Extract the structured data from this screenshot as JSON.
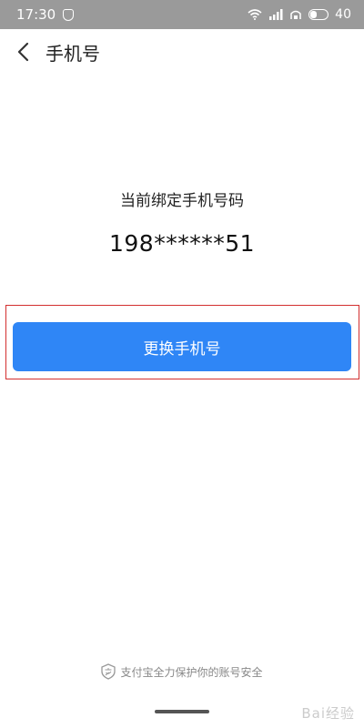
{
  "status_bar": {
    "time": "17:30",
    "battery": "40"
  },
  "header": {
    "title": "手机号",
    "back_icon": "chevron-left-icon"
  },
  "main": {
    "bound_label": "当前绑定手机号码",
    "phone_masked": "198******51",
    "change_button_label": "更换手机号"
  },
  "footer": {
    "security_note": "支付宝全力保护你的账号安全"
  },
  "watermark": {
    "text": "Bai经验"
  },
  "colors": {
    "primary_button": "#2f86f6",
    "highlight_border": "#d32f2f",
    "status_bar_bg": "#9a9a9a"
  }
}
